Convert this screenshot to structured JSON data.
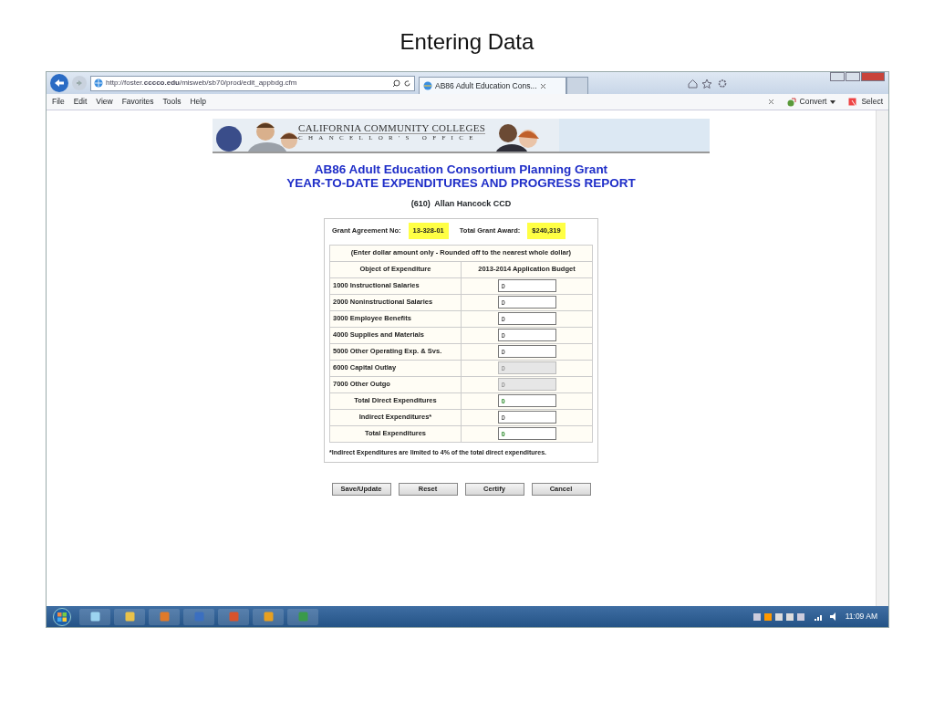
{
  "slide": {
    "title": "Entering Data"
  },
  "browser": {
    "address": "http://foster.**cccco.edu**/misweb/sb70/prod/edit_appbdg.cfm",
    "tabs": [
      {
        "label": "AB86 Adult Education Cons...",
        "selected": true
      }
    ],
    "menu": [
      "File",
      "Edit",
      "View",
      "Favorites",
      "Tools",
      "Help"
    ],
    "commands": [
      "Convert",
      "Select"
    ]
  },
  "page": {
    "logo": {
      "line1": "CALIFORNIA COMMUNITY COLLEGES",
      "line2": "CHANCELLOR'S OFFICE"
    },
    "title": "AB86 Adult Education Consortium Planning Grant",
    "subtitle": "YEAR-TO-DATE EXPENDITURES AND PROGRESS REPORT",
    "district": "(610)  Allan Hancock CCD",
    "grant": {
      "agreement_label": "Grant Agreement No:",
      "agreement_no": "13-328-01",
      "award_label": "Total Grant Award:",
      "award": "$240,319"
    },
    "table": {
      "note": "(Enter dollar amount only - Rounded off to the nearest whole dollar)",
      "columns": [
        "Object of Expenditure",
        "2013-2014 Application Budget"
      ],
      "rows": [
        {
          "label": "1000 Instructional Salaries",
          "value": "0",
          "kind": "item",
          "disabled": false,
          "computed": false
        },
        {
          "label": "2000 Noninstructional Salaries",
          "value": "0",
          "kind": "item",
          "disabled": false,
          "computed": false
        },
        {
          "label": "3000 Employee Benefits",
          "value": "0",
          "kind": "item",
          "disabled": false,
          "computed": false
        },
        {
          "label": "4000 Supplies and Materials",
          "value": "0",
          "kind": "item",
          "disabled": false,
          "computed": false
        },
        {
          "label": "5000 Other Operating Exp. & Svs.",
          "value": "0",
          "kind": "item",
          "disabled": false,
          "computed": false
        },
        {
          "label": "6000 Capital Outlay",
          "value": "0",
          "kind": "item",
          "disabled": true,
          "computed": false
        },
        {
          "label": "7000 Other Outgo",
          "value": "0",
          "kind": "item",
          "disabled": true,
          "computed": false
        },
        {
          "label": "Total Direct Expenditures",
          "value": "0",
          "kind": "summary",
          "disabled": false,
          "computed": true
        },
        {
          "label": "Indirect Expenditures*",
          "value": "0",
          "kind": "summary",
          "disabled": false,
          "computed": false
        },
        {
          "label": "Total Expenditures",
          "value": "0",
          "kind": "summary",
          "disabled": false,
          "computed": true
        }
      ]
    },
    "footnote": "*Indirect Expenditures are limited to 4% of the total direct expenditures.",
    "buttons": [
      "Save/Update",
      "Reset",
      "Certify",
      "Cancel"
    ]
  },
  "taskbar": {
    "clock": "11:09 AM"
  }
}
